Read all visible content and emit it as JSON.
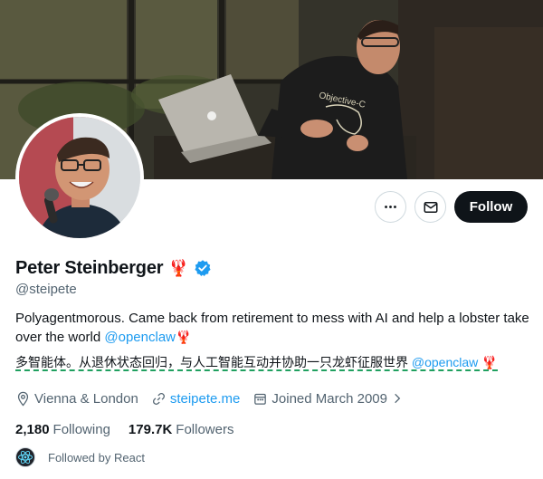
{
  "profile": {
    "display_name": "Peter Steinberger",
    "name_emoji": "🦞",
    "handle": "@steipete",
    "bio_text": "Polyagentmorous. Came back from retirement to mess with AI and help a lobster take over the world ",
    "bio_mention": "@openclaw",
    "bio_emoji": "🦞",
    "bio_cn_text": "多智能体。从退休状态回归，与人工智能互动并协助一只龙虾征服世界 ",
    "bio_cn_mention": "@openclaw",
    "bio_cn_emoji": "🦞",
    "banner_shirt_text": "Objective-C"
  },
  "actions": {
    "more_label": "More",
    "message_label": "Message",
    "follow_label": "Follow"
  },
  "meta": {
    "location": "Vienna & London",
    "website": "steipete.me",
    "joined": "Joined March 2009"
  },
  "counts": {
    "following_num": "2,180",
    "following_label": "Following",
    "followers_num": "179.7K",
    "followers_label": "Followers"
  },
  "followed_by": {
    "text": "Followed by React"
  },
  "colors": {
    "accent": "#1d9bf0",
    "text_primary": "#0f1419",
    "text_secondary": "#536471",
    "follow_bg": "#0f1419",
    "verified": "#1d9bf0"
  },
  "icons": {
    "more": "more-dots-icon",
    "message": "envelope-icon",
    "verified": "verified-badge-icon",
    "location": "location-pin-icon",
    "website": "link-icon",
    "joined": "calendar-icon",
    "joined_chevron": "chevron-right-icon",
    "react": "react-logo-icon"
  }
}
